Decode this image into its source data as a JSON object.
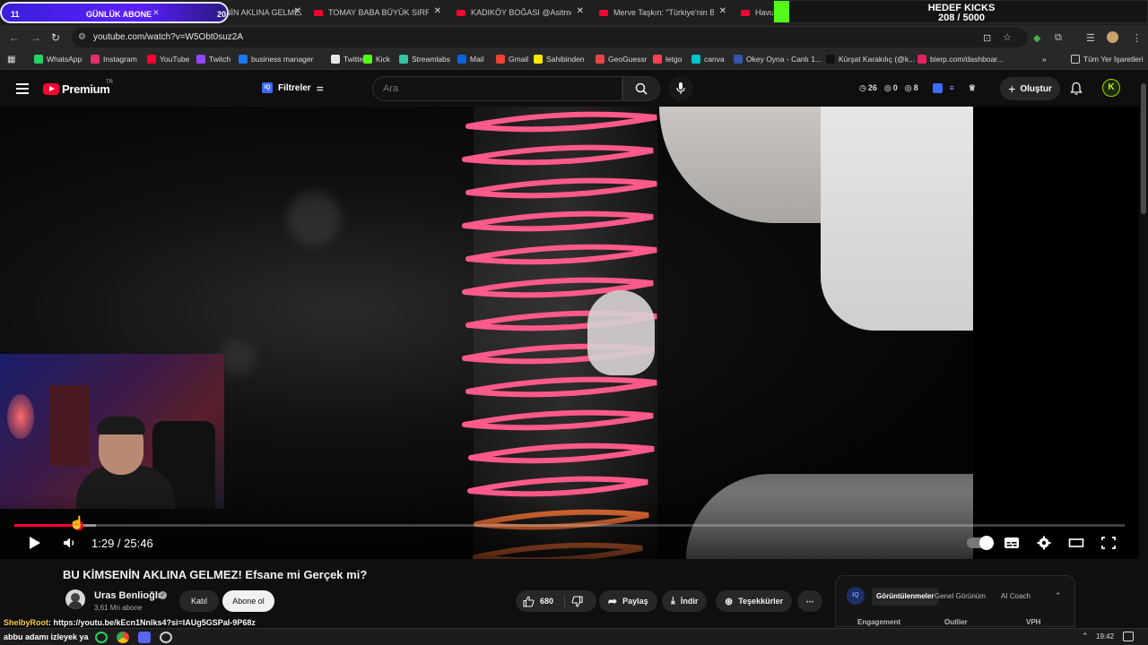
{
  "overlay": {
    "subscriber_goal": {
      "current": "11",
      "title": "GÜNLÜK ABONE",
      "target": "20"
    },
    "kick_goal": {
      "title": "HEDEF KICKS",
      "count": "208 / 5000",
      "progress": 0.0416
    }
  },
  "browser": {
    "tabs": [
      {
        "label": "BU KİMSENİN AKLINA GELMEZ!",
        "active": true
      },
      {
        "label": "TOMAY BABA BÜYÜK SIRRI ÇÖZ..."
      },
      {
        "label": "KADIKÖY BOĞASI @Asitmen İLE"
      },
      {
        "label": "Merve Taşkın: \"Türkiye'nin Beni"
      },
      {
        "label": "Havu"
      }
    ],
    "url": "youtube.com/watch?v=W5Obt0suz2A",
    "bookmarks": [
      {
        "label": "WhatsApp",
        "color": "#25d366"
      },
      {
        "label": "Instagram",
        "color": "#e1306c"
      },
      {
        "label": "YouTube",
        "color": "#ff0033"
      },
      {
        "label": "Twitch",
        "color": "#9146ff"
      },
      {
        "label": "business manager",
        "color": "#1877f2"
      },
      {
        "label": "Twitter",
        "color": "#e7e7e7"
      },
      {
        "label": "Kick",
        "color": "#53fc18"
      },
      {
        "label": "Streamlabs",
        "color": "#31c3a2"
      },
      {
        "label": "Mail",
        "color": "#0a64d8"
      },
      {
        "label": "Gmail",
        "color": "#ea4335"
      },
      {
        "label": "Sahibinden",
        "color": "#ffe800"
      },
      {
        "label": "GeoGuessr",
        "color": "#e64545"
      },
      {
        "label": "letgo",
        "color": "#ff3f55"
      },
      {
        "label": "canva",
        "color": "#00c4cc"
      },
      {
        "label": "Okey Oyna - Canlı 1...",
        "color": "#3355aa"
      },
      {
        "label": "Kürşat Karakılıç (@k...",
        "color": "#111111"
      },
      {
        "label": "bierp.com/dashboar...",
        "color": "#e0245e"
      }
    ],
    "all_bookmarks_label": "Tüm Yer İşaretleri"
  },
  "youtube": {
    "brand": "Premium",
    "region": "TR",
    "filters_label": "Filtreler",
    "search_placeholder": "Ara",
    "stats": {
      "a": "26",
      "b": "0",
      "c": "8"
    },
    "create_label": "Oluştur",
    "avatar_letter": "K"
  },
  "player": {
    "current_time": "1:29",
    "duration": "25:46",
    "time_display": "1:29 / 25:46",
    "progress": 0.0576,
    "buffered": 0.0735
  },
  "video": {
    "title": "BU KİMSENİN AKLINA GELMEZ! Efsane mi Gerçek mi?",
    "channel": "Uras Benlioğlu",
    "subscribers": "3,61 Mn abone",
    "join_label": "Katıl",
    "subscribe_label": "Abone ol",
    "likes": "680",
    "share_label": "Paylaş",
    "download_label": "İndir",
    "thanks_label": "Teşekkürler"
  },
  "sidepanel": {
    "logo": "IQ",
    "tabs": [
      "Görüntülenmeler",
      "Genel Görünüm",
      "AI Coach"
    ],
    "columns": [
      "Engagement",
      "Outlier",
      "VPH"
    ]
  },
  "chat": {
    "user": "ShelbyRoot",
    "message": ": https://youtu.be/kEcn1Nnlks4?si=IAUg5GSPaI-9P68z"
  },
  "taskbar": {
    "ticker": "abbu adamı izleyek ya",
    "clock": "19:42"
  }
}
